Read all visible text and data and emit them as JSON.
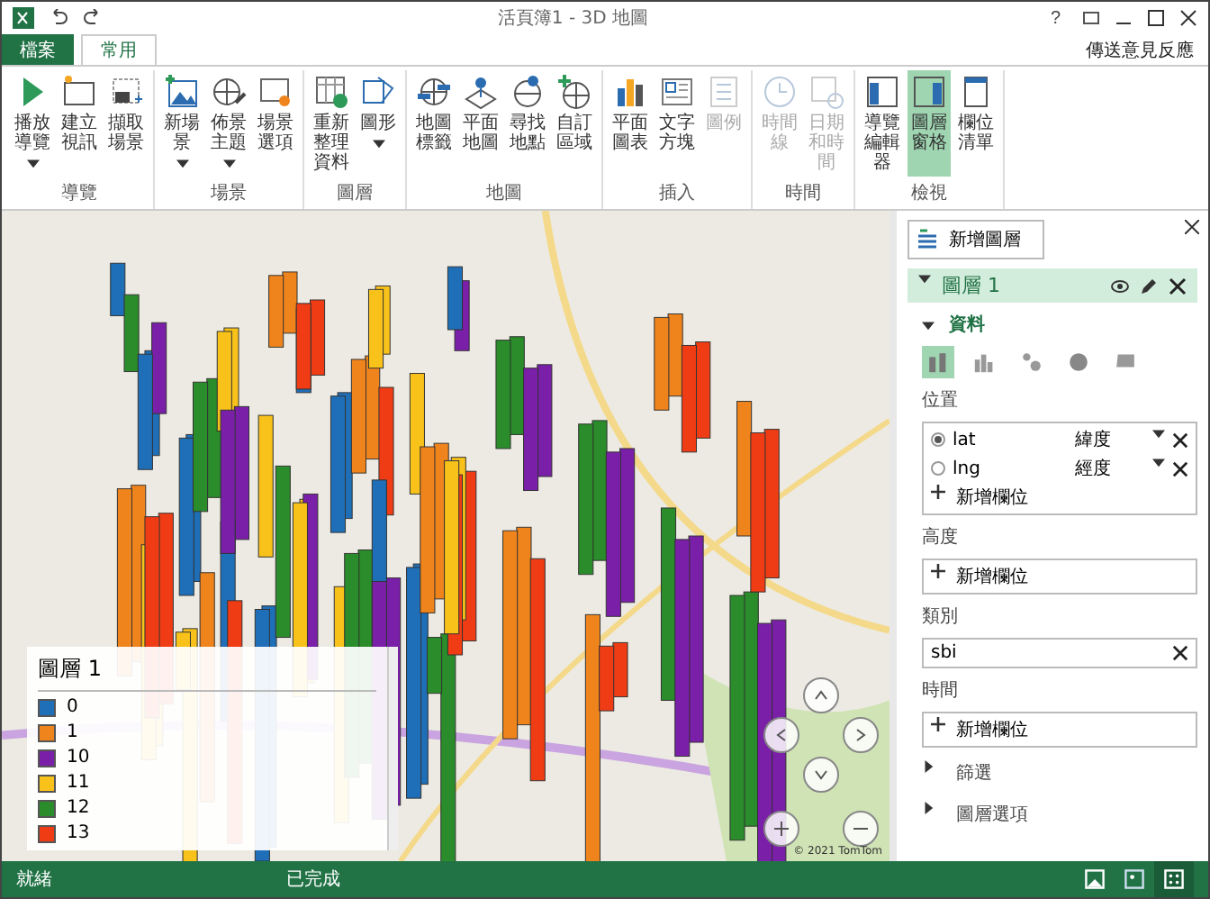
{
  "window": {
    "title": "活頁簿1 - 3D 地圖",
    "help": "?",
    "feedback": "傳送意見反應"
  },
  "tabs": [
    {
      "label": "檔案",
      "kind": "file",
      "selected": false
    },
    {
      "label": "常用",
      "kind": "normal",
      "selected": true
    }
  ],
  "ribbon": [
    {
      "label": "導覽",
      "buttons": [
        {
          "label": "播放導覽",
          "dropdown": true,
          "disabled": false,
          "selected": false
        },
        {
          "label": "建立視訊",
          "dropdown": false,
          "disabled": false,
          "selected": false
        },
        {
          "label": "擷取場景",
          "dropdown": false,
          "disabled": false,
          "selected": false
        }
      ]
    },
    {
      "label": "場景",
      "buttons": [
        {
          "label": "新場景",
          "dropdown": true,
          "disabled": false,
          "selected": false
        },
        {
          "label": "佈景主題",
          "dropdown": true,
          "disabled": false,
          "selected": false
        },
        {
          "label": "場景選項",
          "dropdown": false,
          "disabled": false,
          "selected": false
        }
      ]
    },
    {
      "label": "圖層",
      "buttons": [
        {
          "label": "重新整理資料",
          "dropdown": false,
          "disabled": false,
          "selected": false
        },
        {
          "label": "圖形",
          "dropdown": true,
          "disabled": false,
          "selected": false
        }
      ]
    },
    {
      "label": "地圖",
      "buttons": [
        {
          "label": "地圖標籤",
          "dropdown": false,
          "disabled": false,
          "selected": false
        },
        {
          "label": "平面地圖",
          "dropdown": false,
          "disabled": false,
          "selected": false
        },
        {
          "label": "尋找地點",
          "dropdown": false,
          "disabled": false,
          "selected": false
        },
        {
          "label": "自訂區域",
          "dropdown": false,
          "disabled": false,
          "selected": false
        }
      ]
    },
    {
      "label": "插入",
      "buttons": [
        {
          "label": "平面圖表",
          "dropdown": false,
          "disabled": false,
          "selected": false
        },
        {
          "label": "文字方塊",
          "dropdown": false,
          "disabled": false,
          "selected": false
        },
        {
          "label": "圖例",
          "dropdown": false,
          "disabled": true,
          "selected": false
        }
      ]
    },
    {
      "label": "時間",
      "buttons": [
        {
          "label": "時間線",
          "dropdown": false,
          "disabled": true,
          "selected": false
        },
        {
          "label": "日期和時間",
          "dropdown": false,
          "disabled": true,
          "selected": false
        }
      ]
    },
    {
      "label": "檢視",
      "buttons": [
        {
          "label": "導覽編輯器",
          "dropdown": false,
          "disabled": false,
          "selected": false
        },
        {
          "label": "圖層窗格",
          "dropdown": false,
          "disabled": false,
          "selected": true
        },
        {
          "label": "欄位清單",
          "dropdown": false,
          "disabled": false,
          "selected": false
        }
      ]
    }
  ],
  "legend": {
    "title": "圖層 1",
    "items": [
      {
        "label": "0",
        "color": "#1f6fb8"
      },
      {
        "label": "1",
        "color": "#f0841c"
      },
      {
        "label": "10",
        "color": "#7a1fa8"
      },
      {
        "label": "11",
        "color": "#f8c21a"
      },
      {
        "label": "12",
        "color": "#2a8c2a"
      },
      {
        "label": "13",
        "color": "#f03c14"
      }
    ]
  },
  "map": {
    "attribution": "© 2021 TomTom"
  },
  "panel": {
    "add_layer": "新增圖層",
    "layer": {
      "name": "圖層 1",
      "expanded": true
    },
    "section": {
      "title": "資料",
      "expanded": true
    },
    "chart_types": [
      {
        "selected": true
      },
      {
        "selected": false
      },
      {
        "selected": false
      },
      {
        "selected": false
      },
      {
        "selected": false
      }
    ],
    "location": {
      "label": "位置",
      "fields": [
        {
          "name": "lat",
          "type": "緯度",
          "selected": true
        },
        {
          "name": "lng",
          "type": "經度",
          "selected": false
        }
      ],
      "add": "新增欄位"
    },
    "height": {
      "label": "高度",
      "add": "新增欄位"
    },
    "category": {
      "label": "類別",
      "value": "sbi"
    },
    "time": {
      "label": "時間",
      "add": "新增欄位"
    },
    "sections": [
      {
        "label": "篩選",
        "expanded": false
      },
      {
        "label": "圖層選項",
        "expanded": false
      }
    ]
  },
  "status_bar": {
    "left": "就緒",
    "center": "已完成",
    "views": [
      {
        "selected": false
      },
      {
        "selected": false
      },
      {
        "selected": true
      }
    ]
  }
}
